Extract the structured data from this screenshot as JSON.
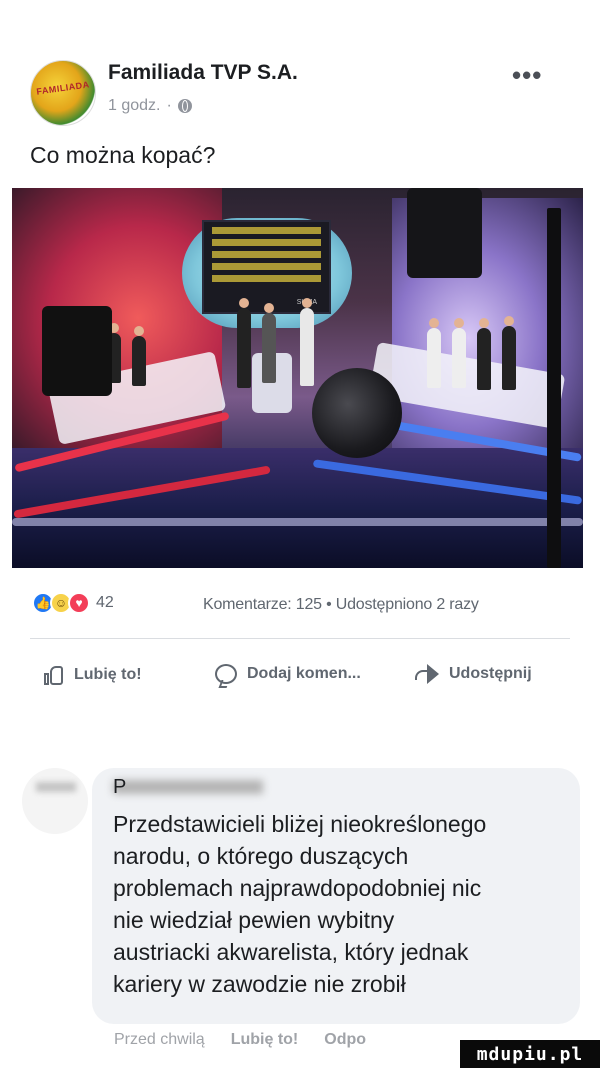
{
  "post": {
    "page_name": "Familiada TVP S.A.",
    "avatar_logo_text": "FAMILIADA",
    "time": "1 godz.",
    "separator": "·",
    "more": "•••",
    "text": "Co można kopać?"
  },
  "photo": {
    "screen_sum_label": "SUMA"
  },
  "reactions": {
    "count": "42",
    "icons": [
      "like-icon",
      "haha-icon",
      "love-icon"
    ]
  },
  "stats": {
    "text": "Komentarze: 125 • Udostępniono 2 razy"
  },
  "actions": {
    "like": "Lubię to!",
    "comment": "Dodaj komen...",
    "share": "Udostępnij"
  },
  "comment": {
    "author_visible": "P",
    "text": "Przedstawicieli bliżej nieokreślonego\nnarodu, o którego duszących\nproblemach najprawdopodobniej nic\nnie wiedział pewien wybitny\naustriacki akwarelista, który jednak\nkariery w zawodzie nie zrobił",
    "time": "Przed chwilą",
    "like": "Lubię to!",
    "reply": "Odpo"
  },
  "watermark": "mdupiu.pl",
  "colors": {
    "like_blue": "#2078f4",
    "love_red": "#f33e58",
    "haha_yellow": "#f7d24a",
    "muted_text": "#606770",
    "bubble_bg": "#f0f2f5"
  }
}
